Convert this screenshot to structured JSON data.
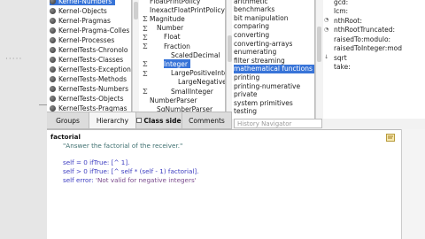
{
  "categories": [
    "Kernel-Numbers",
    "Kernel-Objects",
    "Kernel-Pragmas",
    "Kernel-Pragma-Colles",
    "Kernel-Processes",
    "KernelTests-Chronolo",
    "KernelTests-Classes",
    "KernelTests-Exception",
    "KernelTests-Methods",
    "KernelTests-Numbers",
    "KernelTests-Objects",
    "KernelTests-Pragmas"
  ],
  "classes": [
    {
      "label": "FloatPrintPolicy",
      "sigma": ""
    },
    {
      "label": "InexactFloatPrintPolicy",
      "sigma": ""
    },
    {
      "label": "Magnitude",
      "sigma": "Σ"
    },
    {
      "label": "Number",
      "sigma": "Σ"
    },
    {
      "label": "Float",
      "sigma": "Σ"
    },
    {
      "label": "Fraction",
      "sigma": "Σ"
    },
    {
      "label": "ScaledDecimal",
      "sigma": ""
    },
    {
      "label": "Integer",
      "sigma": "Σ"
    },
    {
      "label": "LargePositiveInte",
      "sigma": "Σ"
    },
    {
      "label": "LargeNegative",
      "sigma": ""
    },
    {
      "label": "SmallInteger",
      "sigma": "Σ"
    },
    {
      "label": "NumberParser",
      "sigma": ""
    },
    {
      "label": "SqNumberParser",
      "sigma": ""
    }
  ],
  "protocols": [
    "arithmetic",
    "benchmarks",
    "bit manipulation",
    "comparing",
    "converting",
    "converting-arrays",
    "enumerating",
    "filter streaming",
    "mathematical functions",
    "printing",
    "printing-numerative",
    "private",
    "system primitives",
    "testing"
  ],
  "methods": [
    {
      "label": "gcd:",
      "marker": ""
    },
    {
      "label": "lcm:",
      "marker": ""
    },
    {
      "label": "nthRoot:",
      "marker": "◔"
    },
    {
      "label": "nthRootTruncated:",
      "marker": "◔"
    },
    {
      "label": "raisedTo:modulo:",
      "marker": ""
    },
    {
      "label": "raisedToInteger:mod",
      "marker": ""
    },
    {
      "label": "sqrt",
      "marker": "↓"
    },
    {
      "label": "take:",
      "marker": ""
    }
  ],
  "tabs": {
    "groups": "Groups",
    "hierarchy": "Hierarchy",
    "class_side": "Class side",
    "comments": "Comments"
  },
  "history_placeholder": "History Navigator",
  "code": {
    "selector": "factorial",
    "comment": "\"Answer the factorial of the receiver.\"",
    "line1_a": "self = 0 ifTrue: [^ 1].",
    "line2_a": "self > 0 ifTrue: [^ self * (self - 1) factorial].",
    "line3_a": "self error: ",
    "line3_str": "'Not valid for negative integers'"
  },
  "colors": {
    "selection": "#3874d8",
    "keyword": "#3c3cc0",
    "string": "#7a4a8c",
    "comment": "#3d6f6f"
  }
}
